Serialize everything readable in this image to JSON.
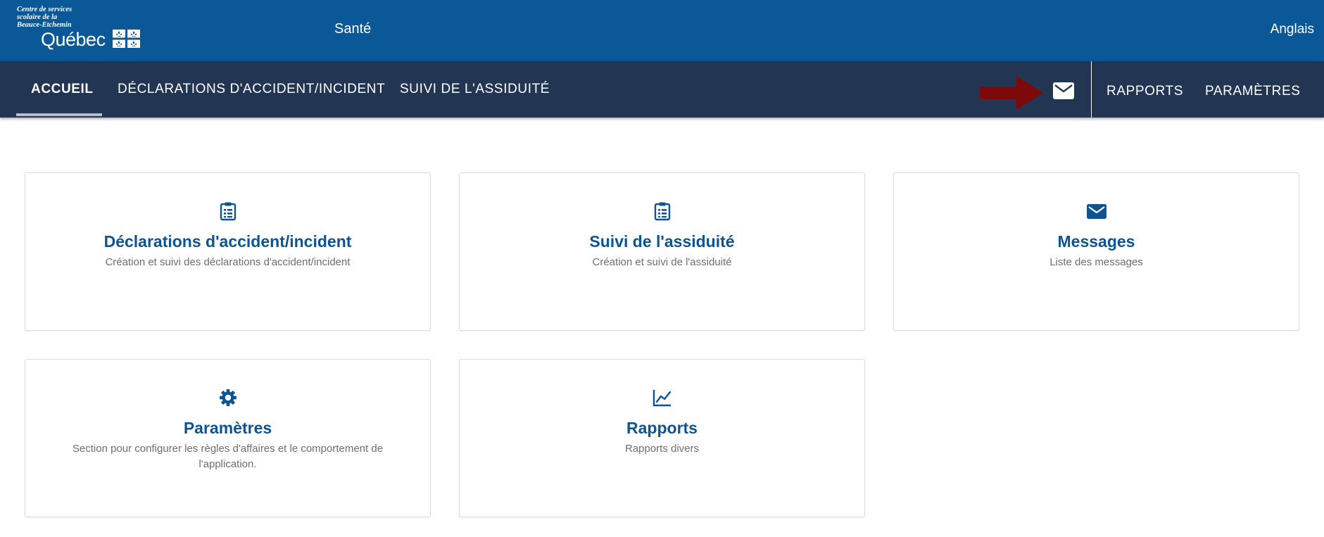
{
  "header": {
    "logo": {
      "line1": "Centre de services",
      "line2": "scolaire de la",
      "line3": "Beauce-Etchemin",
      "wordmark": "Québec"
    },
    "app_title": "Santé",
    "language_link": "Anglais"
  },
  "nav": {
    "items": [
      {
        "label": "ACCUEIL",
        "active": true
      },
      {
        "label": "DÉCLARATIONS D'ACCIDENT/INCIDENT",
        "active": false
      },
      {
        "label": "SUIVI DE L'ASSIDUITÉ",
        "active": false
      }
    ],
    "right_items": [
      {
        "label": "RAPPORTS"
      },
      {
        "label": "PARAMÈTRES"
      }
    ],
    "mail_icon": "envelope-icon",
    "annotation_arrow_color": "#7d0a0a"
  },
  "cards": [
    {
      "icon": "clipboard-list-icon",
      "title": "Déclarations d'accident/incident",
      "description": "Création et suivi des déclarations d'accident/incident"
    },
    {
      "icon": "clipboard-list-icon",
      "title": "Suivi de l'assiduité",
      "description": "Création et suivi de l'assiduité"
    },
    {
      "icon": "envelope-icon",
      "title": "Messages",
      "description": "Liste des messages"
    },
    {
      "icon": "gear-icon",
      "title": "Paramètres",
      "description": "Section pour configurer les règles d'affaires et le comportement de l'application."
    },
    {
      "icon": "line-chart-icon",
      "title": "Rapports",
      "description": "Rapports divers"
    }
  ],
  "colors": {
    "header_bg": "#0b5898",
    "nav_bg": "#223654",
    "accent": "#0e5493",
    "text_muted": "#6e6e6e"
  }
}
